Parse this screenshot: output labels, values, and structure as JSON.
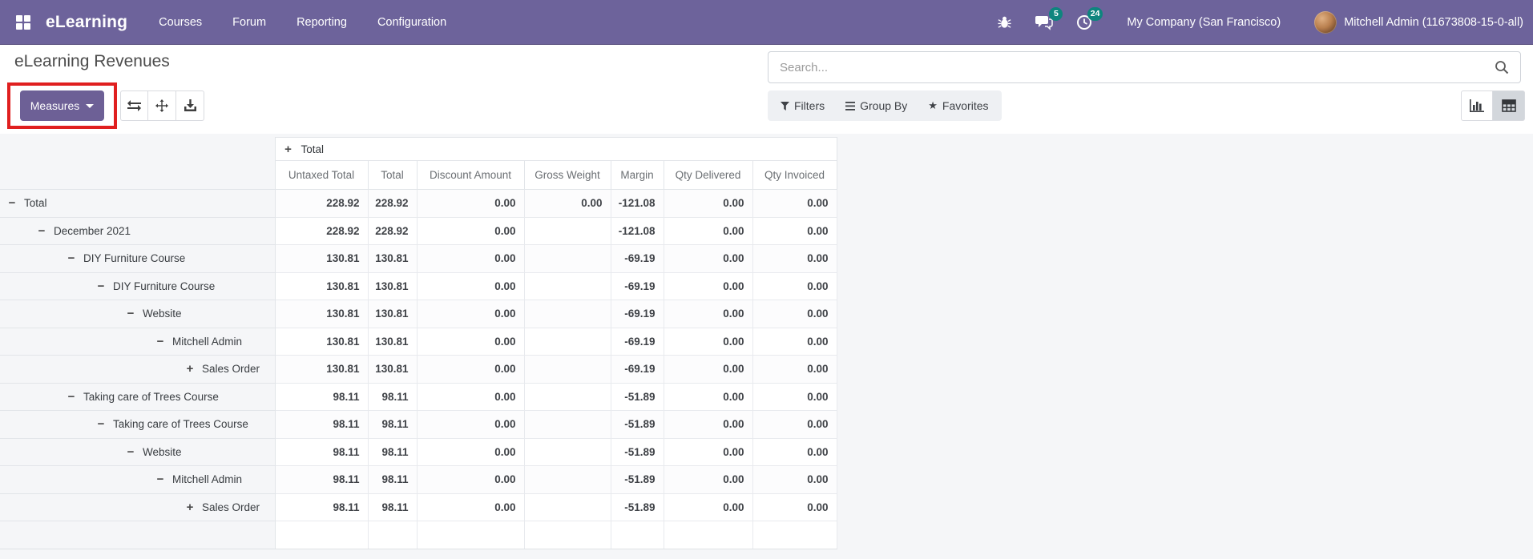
{
  "navbar": {
    "brand": "eLearning",
    "menus": [
      {
        "label": "Courses"
      },
      {
        "label": "Forum"
      },
      {
        "label": "Reporting"
      },
      {
        "label": "Configuration"
      }
    ],
    "messages_count": "5",
    "activities_count": "24",
    "company": "My Company (San Francisco)",
    "user": "Mitchell Admin (11673808-15-0-all)"
  },
  "control_panel": {
    "title": "eLearning Revenues",
    "measures_label": "Measures",
    "search_placeholder": "Search...",
    "filters_label": "Filters",
    "group_by_label": "Group By",
    "favorites_label": "Favorites",
    "view_switcher": {
      "views": [
        "bar-chart",
        "pivot"
      ],
      "active": "pivot"
    }
  },
  "pivot": {
    "top_header": {
      "toggle": "plus",
      "label": "Total"
    },
    "columns": [
      "Untaxed Total",
      "Total",
      "Discount Amount",
      "Gross Weight",
      "Margin",
      "Qty Delivered",
      "Qty Invoiced"
    ],
    "rows": [
      {
        "label": "Total",
        "level": 0,
        "toggle": "minus",
        "values": [
          "228.92",
          "228.92",
          "0.00",
          "0.00",
          "-121.08",
          "0.00",
          "0.00"
        ]
      },
      {
        "label": "December 2021",
        "level": 1,
        "toggle": "minus",
        "values": [
          "228.92",
          "228.92",
          "0.00",
          "",
          "-121.08",
          "0.00",
          "0.00"
        ]
      },
      {
        "label": "DIY Furniture Course",
        "level": 2,
        "toggle": "minus",
        "values": [
          "130.81",
          "130.81",
          "0.00",
          "",
          "-69.19",
          "0.00",
          "0.00"
        ]
      },
      {
        "label": "DIY Furniture Course",
        "level": 3,
        "toggle": "minus",
        "values": [
          "130.81",
          "130.81",
          "0.00",
          "",
          "-69.19",
          "0.00",
          "0.00"
        ]
      },
      {
        "label": "Website",
        "level": 4,
        "toggle": "minus",
        "values": [
          "130.81",
          "130.81",
          "0.00",
          "",
          "-69.19",
          "0.00",
          "0.00"
        ]
      },
      {
        "label": "Mitchell Admin",
        "level": 5,
        "toggle": "minus",
        "values": [
          "130.81",
          "130.81",
          "0.00",
          "",
          "-69.19",
          "0.00",
          "0.00"
        ]
      },
      {
        "label": "Sales Order",
        "level": 6,
        "toggle": "plus",
        "values": [
          "130.81",
          "130.81",
          "0.00",
          "",
          "-69.19",
          "0.00",
          "0.00"
        ]
      },
      {
        "label": "Taking care of Trees Course",
        "level": 2,
        "toggle": "minus",
        "values": [
          "98.11",
          "98.11",
          "0.00",
          "",
          "-51.89",
          "0.00",
          "0.00"
        ]
      },
      {
        "label": "Taking care of Trees Course",
        "level": 3,
        "toggle": "minus",
        "values": [
          "98.11",
          "98.11",
          "0.00",
          "",
          "-51.89",
          "0.00",
          "0.00"
        ]
      },
      {
        "label": "Website",
        "level": 4,
        "toggle": "minus",
        "values": [
          "98.11",
          "98.11",
          "0.00",
          "",
          "-51.89",
          "0.00",
          "0.00"
        ]
      },
      {
        "label": "Mitchell Admin",
        "level": 5,
        "toggle": "minus",
        "values": [
          "98.11",
          "98.11",
          "0.00",
          "",
          "-51.89",
          "0.00",
          "0.00"
        ]
      },
      {
        "label": "Sales Order",
        "level": 6,
        "toggle": "plus",
        "values": [
          "98.11",
          "98.11",
          "0.00",
          "",
          "-51.89",
          "0.00",
          "0.00"
        ]
      }
    ]
  },
  "colors": {
    "navbar": "#6d639b",
    "badge_teal": "#0e857e",
    "measures_button": "#6d6096",
    "annotation_red": "#e01f1f",
    "content_background": "#f5f6f8",
    "table_border": "#e2e5e9"
  }
}
